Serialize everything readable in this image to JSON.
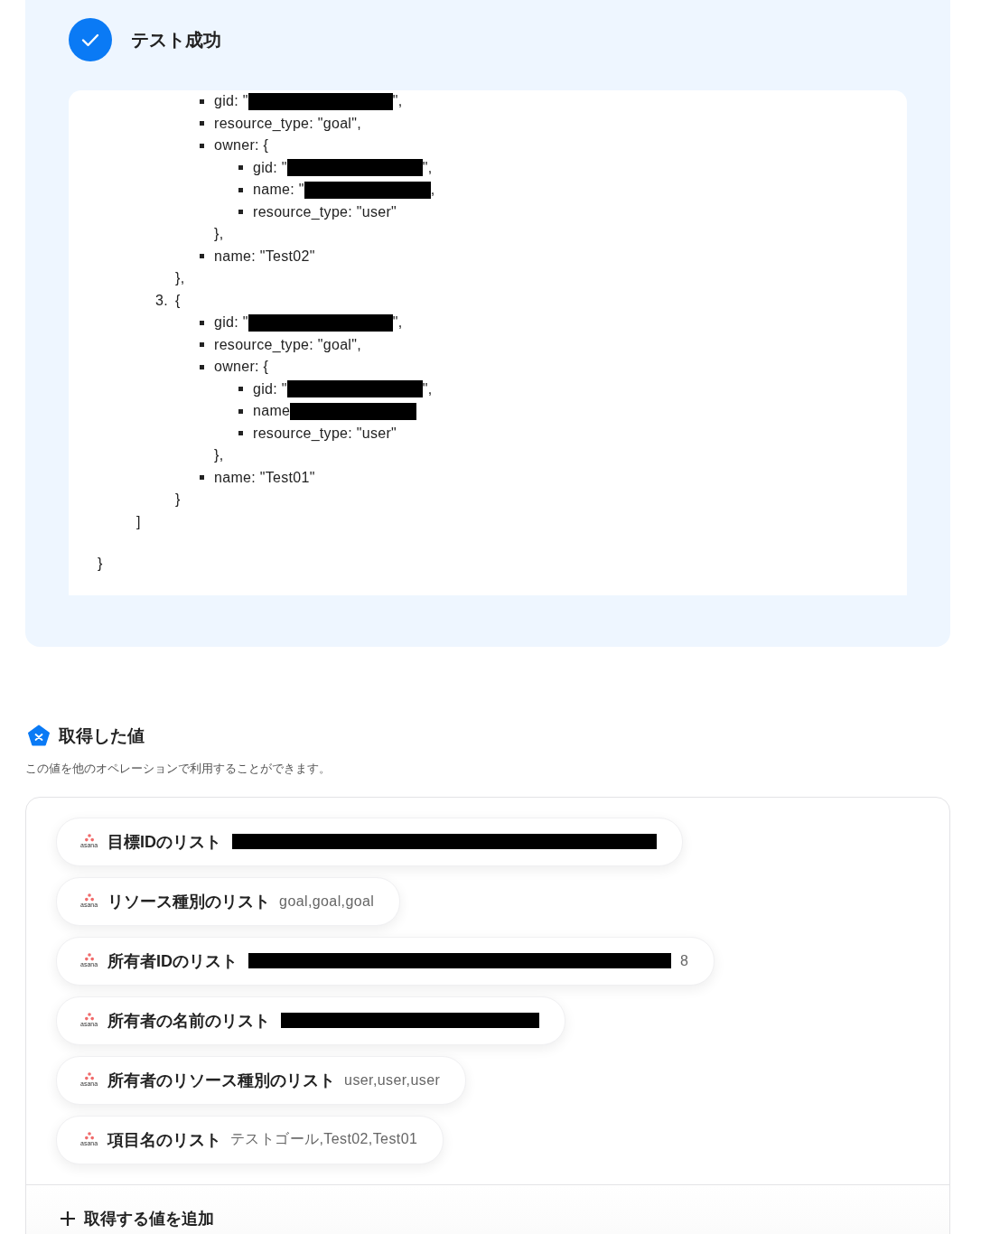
{
  "test_result": {
    "title": "テスト成功",
    "code": {
      "close": "}",
      "children": [
        {
          "close": "]",
          "children": [
            {
              "close": "},",
              "children": [
                {
                  "open": "gid: \"",
                  "redacted": true,
                  "after": "\","
                },
                {
                  "open": "resource_type: \"goal\","
                },
                {
                  "open": "owner: {",
                  "close": "},",
                  "children": [
                    {
                      "open": "gid: \"",
                      "redacted": true,
                      "after": "\","
                    },
                    {
                      "open": "name: \"",
                      "redacted": true,
                      "after": ","
                    },
                    {
                      "open": "resource_type: \"user\""
                    }
                  ]
                },
                {
                  "open": "name: \"Test02\""
                }
              ]
            },
            {
              "marker": "3.",
              "open": "{",
              "close": "}",
              "children": [
                {
                  "open": "gid: \"",
                  "redacted": true,
                  "after": "\","
                },
                {
                  "open": "resource_type: \"goal\","
                },
                {
                  "open": "owner: {",
                  "close": "},",
                  "children": [
                    {
                      "open": "gid: \"",
                      "redacted": true,
                      "after": "\","
                    },
                    {
                      "open": "name",
                      "redacted": true
                    },
                    {
                      "open": "resource_type: \"user\""
                    }
                  ]
                },
                {
                  "open": "name: \"Test01\""
                }
              ]
            }
          ]
        }
      ]
    }
  },
  "values_section": {
    "title": "取得した値",
    "description": "この値を他のオペレーションで利用することができます。",
    "values": [
      {
        "app": "asana",
        "label": "目標IDのリスト",
        "redacted": true
      },
      {
        "app": "asana",
        "label": "リソース種別のリスト",
        "value": "goal,goal,goal"
      },
      {
        "app": "asana",
        "label": "所有者IDのリスト",
        "redacted": true,
        "after": "8"
      },
      {
        "app": "asana",
        "label": "所有者の名前のリスト",
        "redacted": true
      },
      {
        "app": "asana",
        "label": "所有者のリソース種別のリスト",
        "value": "user,user,user"
      },
      {
        "app": "asana",
        "label": "項目名のリスト",
        "value": "テストゴール,Test02,Test01"
      }
    ],
    "add_button": {
      "label": "取得する値を追加"
    }
  }
}
